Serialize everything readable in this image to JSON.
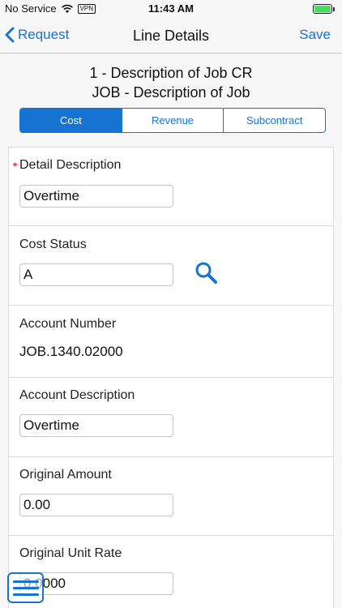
{
  "status_bar": {
    "carrier": "No Service",
    "vpn": "VPN",
    "time": "11:43 AM"
  },
  "nav": {
    "back_label": "Request",
    "title": "Line Details",
    "save_label": "Save"
  },
  "header": {
    "line1": "1 - Description of Job CR",
    "line2": "JOB - Description of Job"
  },
  "tabs": [
    {
      "label": "Cost",
      "active": true
    },
    {
      "label": "Revenue",
      "active": false
    },
    {
      "label": "Subcontract",
      "active": false
    }
  ],
  "fields": {
    "detail_description": {
      "label": "Detail Description",
      "required_mark": "*",
      "value": "Overtime"
    },
    "cost_status": {
      "label": "Cost Status",
      "value": "A"
    },
    "account_number": {
      "label": "Account Number",
      "value": "JOB.1340.02000"
    },
    "account_description": {
      "label": "Account Description",
      "value": "Overtime"
    },
    "original_amount": {
      "label": "Original Amount",
      "value": "0.00"
    },
    "original_unit_rate": {
      "label": "Original Unit Rate",
      "value": "0.0000"
    }
  },
  "colors": {
    "accent": "#1673d2",
    "required": "#d0021b",
    "battery": "#4cd964"
  },
  "icons": {
    "back": "chevron-left-icon",
    "search": "magnifier-icon",
    "menu": "hamburger-icon"
  }
}
